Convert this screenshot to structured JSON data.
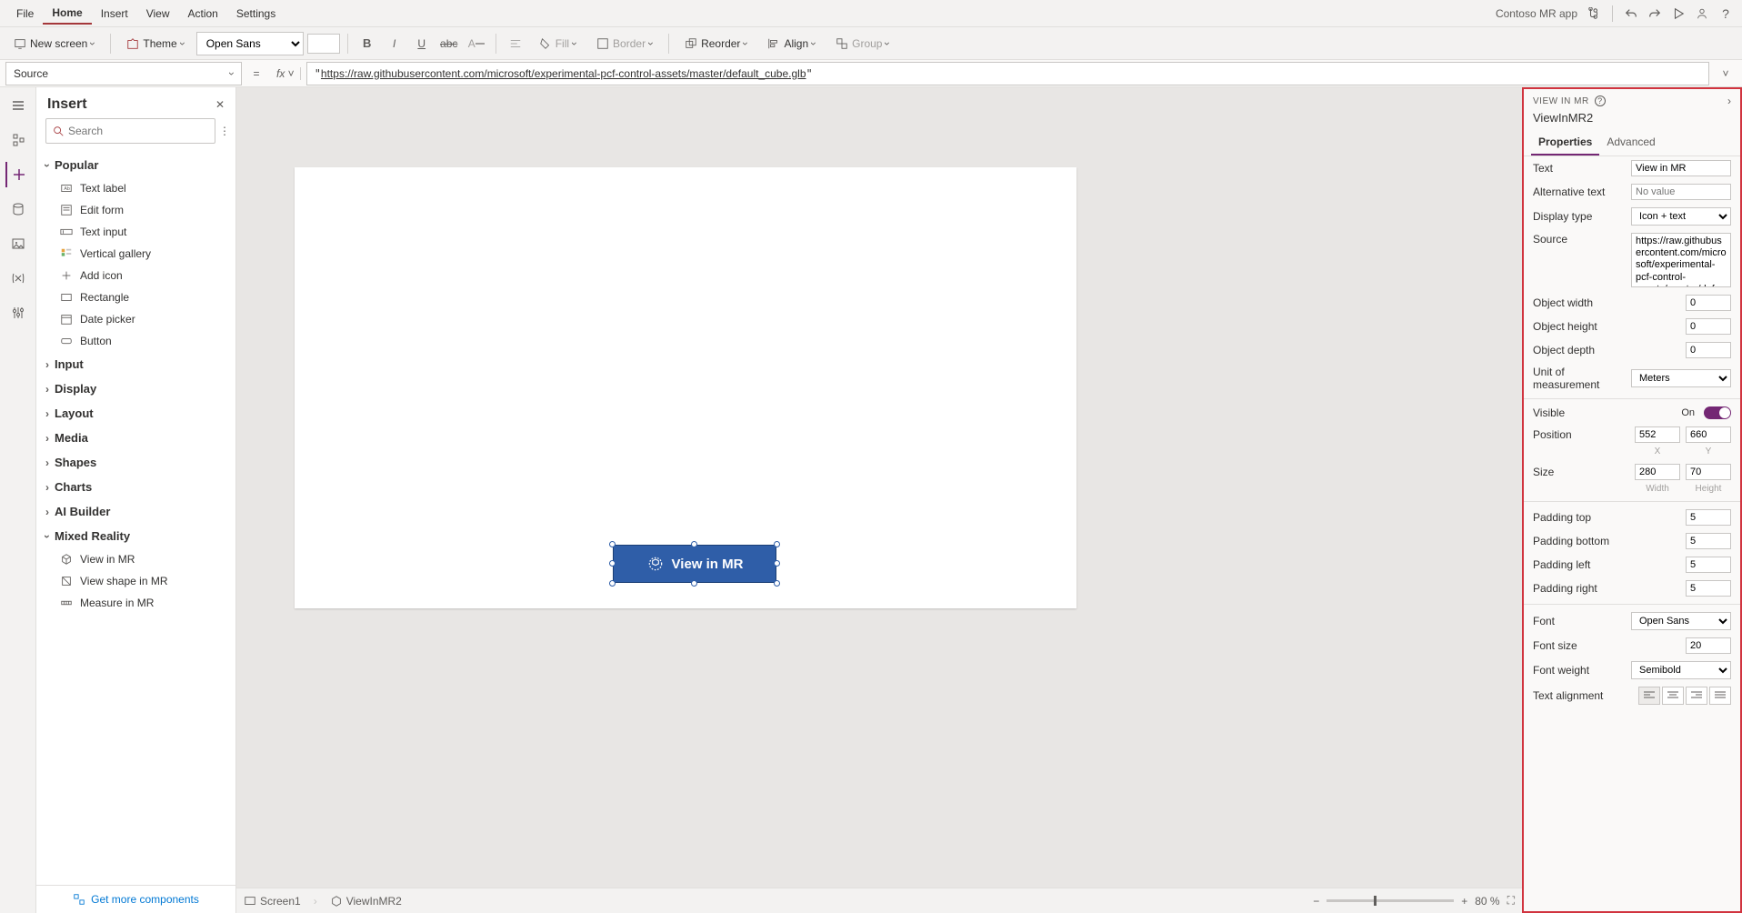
{
  "app_title": "Contoso MR app",
  "menubar": [
    "File",
    "Home",
    "Insert",
    "View",
    "Action",
    "Settings"
  ],
  "menubar_active": 1,
  "ribbon": {
    "new_screen": "New screen",
    "theme": "Theme",
    "font": "Open Sans",
    "fill": "Fill",
    "border": "Border",
    "reorder": "Reorder",
    "align": "Align",
    "group": "Group"
  },
  "formula": {
    "property": "Source",
    "value": "https://raw.githubusercontent.com/microsoft/experimental-pcf-control-assets/master/default_cube.glb"
  },
  "insert": {
    "title": "Insert",
    "search_placeholder": "Search",
    "popular": "Popular",
    "popular_items": [
      "Text label",
      "Edit form",
      "Text input",
      "Vertical gallery",
      "Add icon",
      "Rectangle",
      "Date picker",
      "Button"
    ],
    "categories": [
      "Input",
      "Display",
      "Layout",
      "Media",
      "Shapes",
      "Charts",
      "AI Builder",
      "Mixed Reality"
    ],
    "mr_items": [
      "View in MR",
      "View shape in MR",
      "Measure in MR"
    ],
    "footer": "Get more components"
  },
  "canvas": {
    "button_label": "View in MR"
  },
  "statusbar": {
    "screen": "Screen1",
    "control": "ViewInMR2",
    "zoom": "80 %"
  },
  "properties": {
    "header": "VIEW IN MR",
    "name": "ViewInMR2",
    "tabs": [
      "Properties",
      "Advanced"
    ],
    "text_label": "Text",
    "text_value": "View in MR",
    "alt_label": "Alternative text",
    "alt_placeholder": "No value",
    "display_label": "Display type",
    "display_value": "Icon + text",
    "source_label": "Source",
    "source_value": "https://raw.githubusercontent.com/microsoft/experimental-pcf-control-assets/master/default_",
    "ow_label": "Object width",
    "ow": "0",
    "oh_label": "Object height",
    "oh": "0",
    "od_label": "Object depth",
    "od": "0",
    "unit_label": "Unit of measurement",
    "unit": "Meters",
    "visible_label": "Visible",
    "visible_on": "On",
    "pos_label": "Position",
    "pos_x": "552",
    "pos_y": "660",
    "x": "X",
    "y": "Y",
    "size_label": "Size",
    "size_w": "280",
    "size_h": "70",
    "w": "Width",
    "h": "Height",
    "pt_label": "Padding top",
    "pt": "5",
    "pb_label": "Padding bottom",
    "pb": "5",
    "pl_label": "Padding left",
    "pl": "5",
    "pr_label": "Padding right",
    "pr": "5",
    "font_label": "Font",
    "font": "Open Sans",
    "fs_label": "Font size",
    "fs": "20",
    "fw_label": "Font weight",
    "fw": "Semibold",
    "ta_label": "Text alignment"
  }
}
